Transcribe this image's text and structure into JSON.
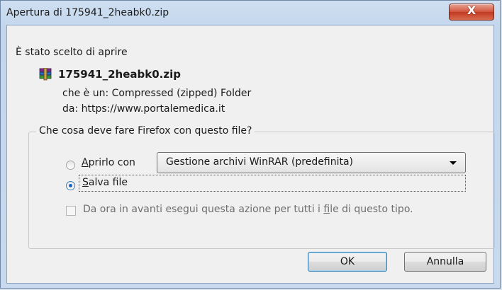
{
  "window": {
    "title": "Apertura di 175941_2heabk0.zip",
    "close_label": "X"
  },
  "dialog": {
    "chosen_label": "È stato scelto di aprire",
    "file_name": "175941_2heabk0.zip",
    "type_line": "che è un:  Compressed (zipped) Folder",
    "from_line": "da:  https://www.portalemedica.it",
    "file_icon": "winrar-archive-icon"
  },
  "action_group": {
    "legend": "Che cosa deve fare Firefox con questo file?",
    "open_with": {
      "label_first": "A",
      "label_rest": "prirlo con",
      "selected": false
    },
    "app_select": {
      "value": "Gestione archivi WinRAR (predefinita)"
    },
    "save_file": {
      "label_first": "S",
      "label_rest": "alva file",
      "selected": true
    },
    "always": {
      "label_pre": "Da ora in avanti esegui questa azione per tutti i ",
      "label_u": "f",
      "label_post": "ile di questo tipo.",
      "checked": false
    }
  },
  "buttons": {
    "ok": "OK",
    "cancel": "Annulla"
  }
}
